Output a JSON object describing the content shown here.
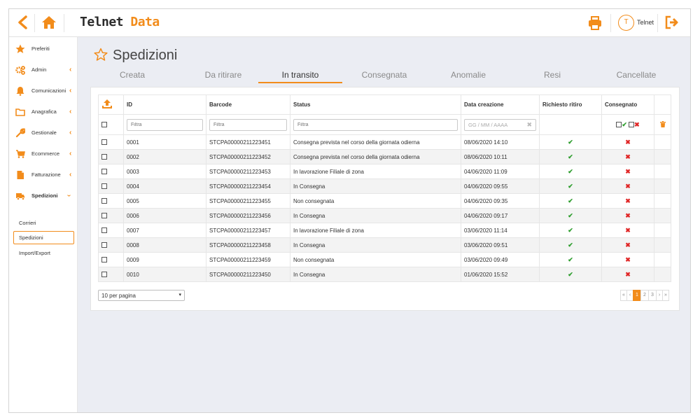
{
  "header": {
    "logo_main": "Telnet",
    "logo_accent": "Data",
    "user_initial": "T",
    "user_name": "Telnet"
  },
  "sidebar": {
    "items": [
      {
        "label": "Preferiti",
        "icon": "star-icon"
      },
      {
        "label": "Admin",
        "icon": "cogs-icon"
      },
      {
        "label": "Comunicazioni",
        "icon": "bell-icon"
      },
      {
        "label": "Anagrafica",
        "icon": "folder-icon"
      },
      {
        "label": "Gestionale",
        "icon": "wrench-icon"
      },
      {
        "label": "Ecommerce",
        "icon": "cart-icon"
      },
      {
        "label": "Fatturazione",
        "icon": "document-icon"
      },
      {
        "label": "Spedizioni",
        "icon": "truck-icon"
      }
    ],
    "subitems": [
      "Corrieri",
      "Spedizioni",
      "Import/Export"
    ]
  },
  "page": {
    "title": "Spedizioni",
    "tabs": [
      "Creata",
      "Da ritirare",
      "In transito",
      "Consegnata",
      "Anomalie",
      "Resi",
      "Cancellate"
    ],
    "active_tab": "In transito"
  },
  "table": {
    "columns": [
      "ID",
      "Barcode",
      "Status",
      "Data creazione",
      "Richiesto ritiro",
      "Consegnato"
    ],
    "filter_placeholder": "Filtra",
    "date_placeholder": "GG / MM / AAAA",
    "rows": [
      {
        "id": "0001",
        "barcode": "STCPA00000211223451",
        "status": "Consegna prevista nel corso della giornata odierna",
        "date": "08/06/2020 14:10",
        "ritiro": true,
        "consegnato": false
      },
      {
        "id": "0002",
        "barcode": "STCPA00000211223452",
        "status": "Consegna prevista nel corso della giornata odierna",
        "date": "08/06/2020 10:11",
        "ritiro": true,
        "consegnato": false
      },
      {
        "id": "0003",
        "barcode": "STCPA00000211223453",
        "status": "In lavorazione Filiale di zona",
        "date": "04/06/2020 11:09",
        "ritiro": true,
        "consegnato": false
      },
      {
        "id": "0004",
        "barcode": "STCPA00000211223454",
        "status": "In Consegna",
        "date": "04/06/2020 09:55",
        "ritiro": true,
        "consegnato": false
      },
      {
        "id": "0005",
        "barcode": "STCPA00000211223455",
        "status": "Non consegnata",
        "date": "04/06/2020 09:35",
        "ritiro": true,
        "consegnato": false
      },
      {
        "id": "0006",
        "barcode": "STCPA00000211223456",
        "status": "In Consegna",
        "date": "04/06/2020 09:17",
        "ritiro": true,
        "consegnato": false
      },
      {
        "id": "0007",
        "barcode": "STCPA00000211223457",
        "status": "In lavorazione Filiale di zona",
        "date": "03/06/2020 11:14",
        "ritiro": true,
        "consegnato": false
      },
      {
        "id": "0008",
        "barcode": "STCPA00000211223458",
        "status": "In Consegna",
        "date": "03/06/2020 09:51",
        "ritiro": true,
        "consegnato": false
      },
      {
        "id": "0009",
        "barcode": "STCPA00000211223459",
        "status": "Non consegnata",
        "date": "03/06/2020 09:49",
        "ritiro": true,
        "consegnato": false
      },
      {
        "id": "0010",
        "barcode": "STCPA00000211223450",
        "status": "In Consegna",
        "date": "01/06/2020 15:52",
        "ritiro": true,
        "consegnato": false
      }
    ]
  },
  "footer": {
    "per_page": "10 per pagina",
    "pages": [
      "1",
      "2",
      "3"
    ],
    "current_page": "1",
    "first": "«",
    "prev": "‹",
    "next": "›",
    "last": "»"
  },
  "colors": {
    "accent": "#f28c1b",
    "ok": "#2d9d2d",
    "ko": "#e02525"
  }
}
